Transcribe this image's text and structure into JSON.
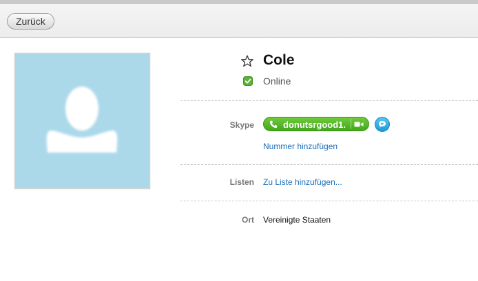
{
  "toolbar": {
    "back_label": "Zurück"
  },
  "profile": {
    "name": "Cole",
    "status": "Online"
  },
  "rows": {
    "skype": {
      "label": "Skype",
      "skype_name": "donutsrgood1.",
      "add_number": "Nummer hinzufügen"
    },
    "lists": {
      "label": "Listen",
      "add_to_list": "Zu Liste hinzufügen..."
    },
    "location": {
      "label": "Ort",
      "value": "Vereinigte Staaten"
    }
  },
  "colors": {
    "avatar_bg": "#acd9ea",
    "call_green": "#4cb623",
    "chat_blue": "#2aa6e0",
    "link": "#1a6dbb",
    "online_green": "#5cb338"
  },
  "icons": [
    "star-icon",
    "online-status-icon",
    "phone-icon",
    "video-icon",
    "chat-icon",
    "default-avatar-icon"
  ]
}
